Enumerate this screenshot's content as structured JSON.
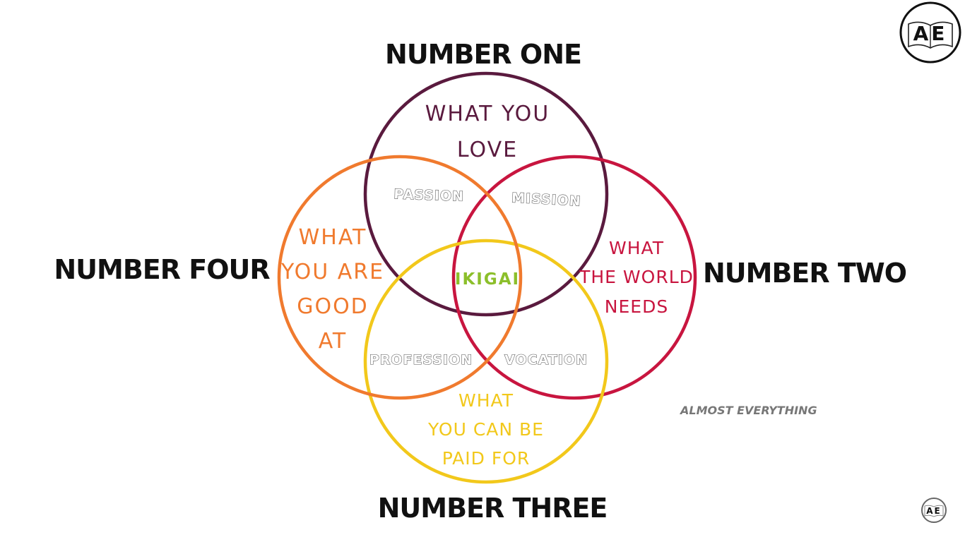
{
  "headings": {
    "top": "NUMBER ONE",
    "right": "NUMBER TWO",
    "bottom": "NUMBER THREE",
    "left": "NUMBER FOUR"
  },
  "sets": {
    "love": {
      "lines": [
        "WHAT YOU",
        "LOVE"
      ],
      "color": "#5a1a3e"
    },
    "world_needs": {
      "lines": [
        "WHAT",
        "THE WORLD",
        "NEEDS"
      ],
      "color": "#c8153f"
    },
    "paid_for": {
      "lines": [
        "WHAT",
        "YOU CAN BE",
        "PAID FOR"
      ],
      "color": "#f2c81b"
    },
    "good_at": {
      "lines": [
        "WHAT",
        "YOU ARE",
        "GOOD",
        "AT"
      ],
      "color": "#f07a2e"
    }
  },
  "overlaps": {
    "passion": "PASSION",
    "mission": "MISSION",
    "profession": "PROFESSION",
    "vocation": "VOCATION"
  },
  "center": {
    "label": "IKIGAI",
    "color": "#8cbf2b"
  },
  "watermark": "ALMOST EVERYTHING",
  "logo": {
    "text": "AE",
    "icon": "open-book-logo-icon"
  }
}
